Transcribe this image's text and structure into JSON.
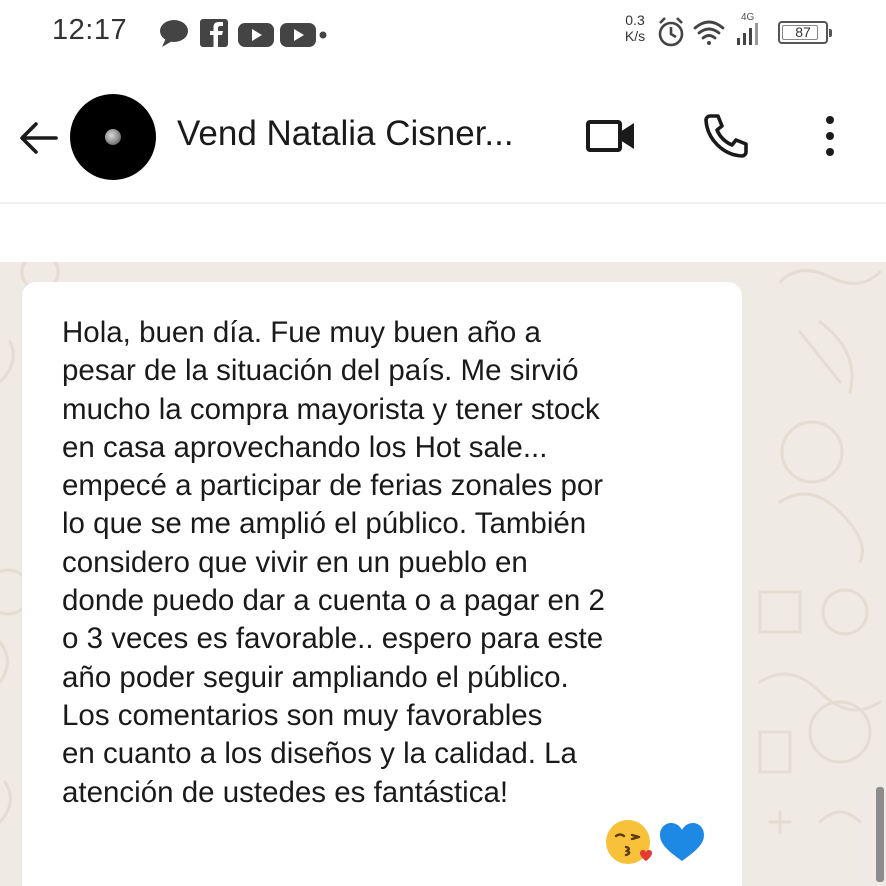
{
  "status_bar": {
    "time": "12:17",
    "network_speed_value": "0.3",
    "network_speed_unit": "K/s",
    "network_type": "4G",
    "battery": "87",
    "notification_icons": [
      "chat-bubble-icon",
      "facebook-icon",
      "youtube-icon",
      "youtube-icon",
      "dot-icon"
    ],
    "system_icons": [
      "alarm-icon",
      "wifi-icon",
      "signal-icon",
      "battery-icon"
    ]
  },
  "header": {
    "contact_name": "Vend Natalia Cisner...",
    "back_icon": "arrow-left-icon",
    "actions": [
      "video-call-icon",
      "phone-icon",
      "more-vertical-icon"
    ]
  },
  "message": {
    "lines": [
      "Hola, buen día. Fue muy buen año a",
      "pesar de la situación del país. Me sirvió",
      "mucho la compra mayorista y tener stock",
      "en casa aprovechando los Hot sale...",
      "empecé a participar de ferias zonales por",
      "lo que se me amplió el público. También",
      "considero que vivir en un pueblo en",
      "donde puedo dar a cuenta o a pagar en 2",
      "o 3 veces es favorable.. espero para este",
      "año poder seguir ampliando el público.",
      "Los comentarios son muy favorables",
      "en cuanto a los diseños y la calidad. La",
      "atención de ustedes es fantástica!"
    ],
    "emojis": [
      "face-blowing-kiss-icon",
      "blue-heart-icon"
    ]
  },
  "colors": {
    "chat_background": "#efeae3",
    "bubble": "#ffffff",
    "text": "#1a1a1a",
    "heart": "#1e88e5"
  }
}
